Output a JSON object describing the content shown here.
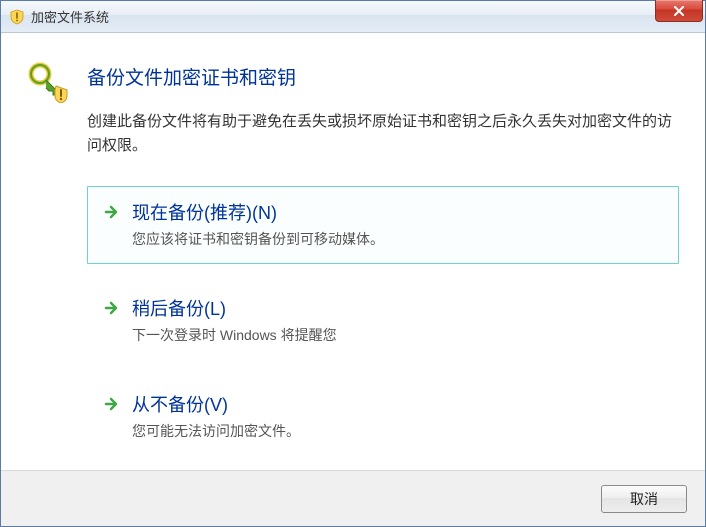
{
  "window": {
    "title": "加密文件系统"
  },
  "main": {
    "heading": "备份文件加密证书和密钥",
    "description": "创建此备份文件将有助于避免在丢失或损坏原始证书和密钥之后永久丢失对加密文件的访问权限。"
  },
  "options": [
    {
      "title": "现在备份(推荐)(N)",
      "subtitle": "您应该将证书和密钥备份到可移动媒体。",
      "selected": true
    },
    {
      "title": "稍后备份(L)",
      "subtitle": "下一次登录时 Windows 将提醒您",
      "selected": false
    },
    {
      "title": "从不备份(V)",
      "subtitle": "您可能无法访问加密文件。",
      "selected": false
    }
  ],
  "footer": {
    "cancel_label": "取消"
  }
}
